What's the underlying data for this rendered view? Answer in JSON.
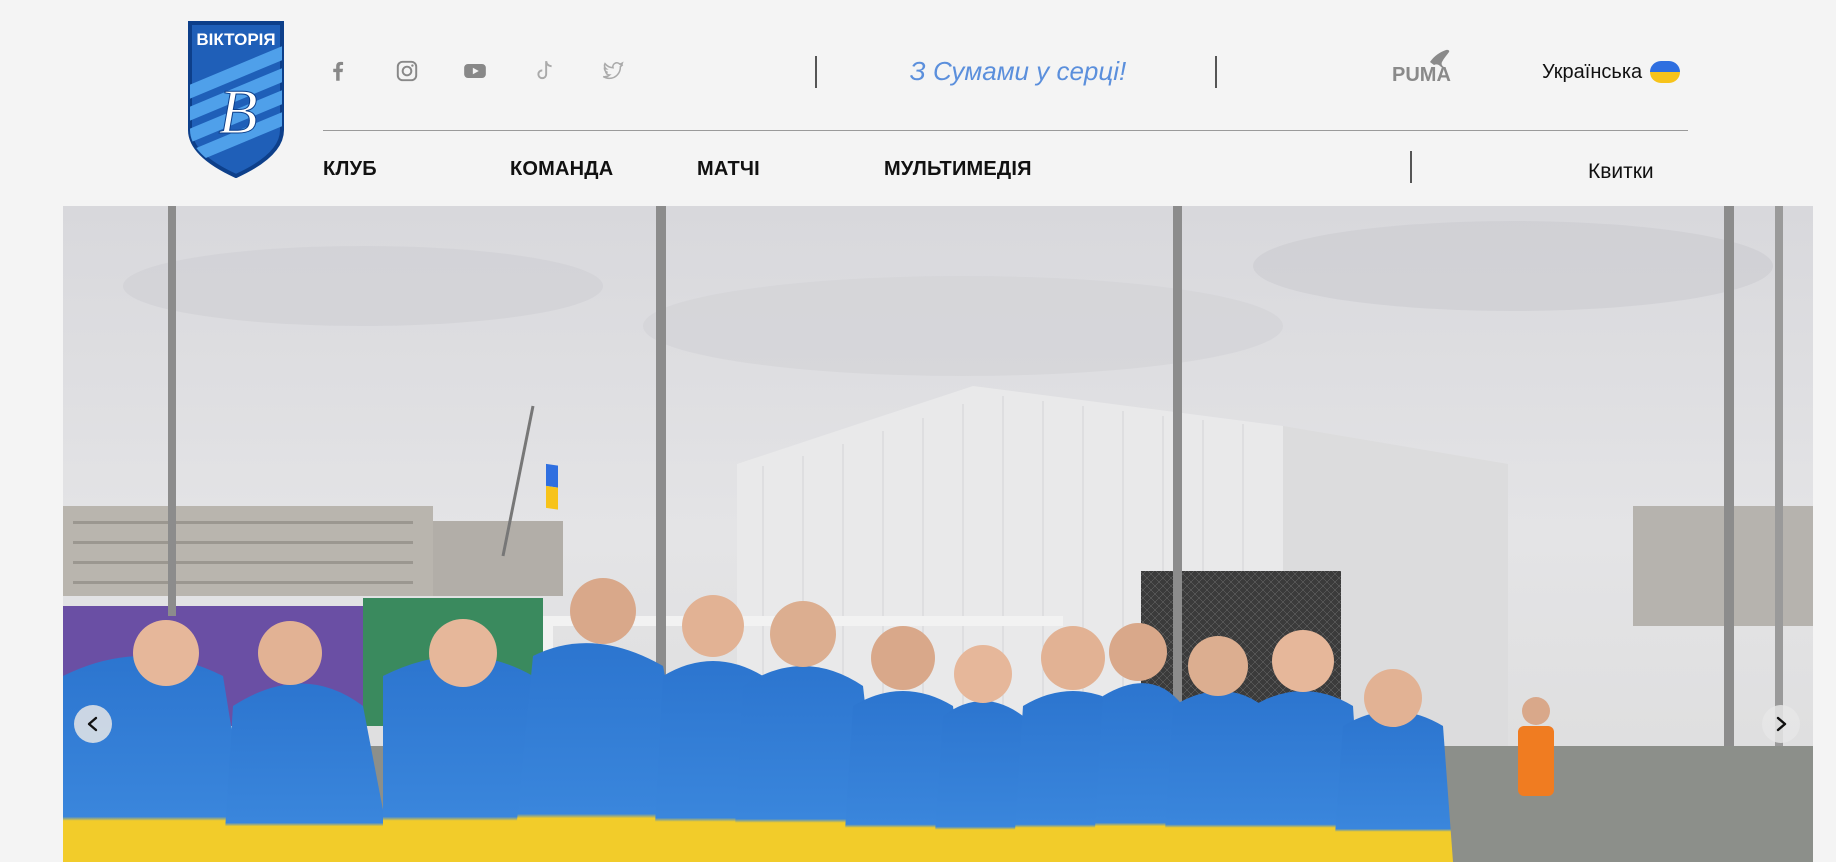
{
  "header": {
    "logo": {
      "name": "club-logo",
      "text": "ВІКТОРІЯ",
      "letter": "В",
      "colors": {
        "shield": "#1f5fb8",
        "stripe": "#4fa0ea",
        "border": "#0d3f8a"
      }
    },
    "social": [
      {
        "name": "facebook-icon"
      },
      {
        "name": "instagram-icon"
      },
      {
        "name": "youtube-icon"
      },
      {
        "name": "tiktok-icon"
      },
      {
        "name": "twitter-icon"
      }
    ],
    "slogan": "З Сумами у серці!",
    "sponsor_icon": "puma-logo-icon",
    "sponsor_text": "PUMA",
    "language": "Українська",
    "language_flag": "ukraine-flag-icon"
  },
  "nav": {
    "items": [
      {
        "label": "КЛУБ"
      },
      {
        "label": "КОМАНДА"
      },
      {
        "label": "МАТЧІ"
      },
      {
        "label": "МУЛЬТИМЕДІЯ"
      }
    ],
    "tickets": "Квитки"
  },
  "hero": {
    "image": "team-photo-with-ukrainian-flags",
    "prev_icon": "chevron-left-icon",
    "next_icon": "chevron-right-icon"
  },
  "colors": {
    "background": "#f4f4f4",
    "accent": "#5b8fdc",
    "flag_blue": "#2f6fe0",
    "flag_yellow": "#f7c31a"
  }
}
